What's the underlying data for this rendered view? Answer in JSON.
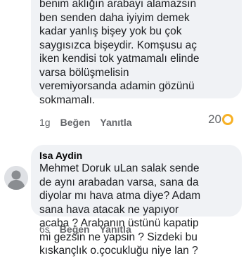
{
  "comments": [
    {
      "text": "benim aklığın arabayı alamazsın\nben senden daha iyiyim demek\nkadar yanlış bişey yok bu çok\nsaygısızca bişeydir. Komşusu aç\niken kendisi tok yatmamalı elinde\nvarsa bölüşmelisin\nveremiyorsanda adamin gözünü\nsokmamalı.",
      "time": "1g",
      "like_label": "Beğen",
      "reply_label": "Yanıtla",
      "reaction_count": "20",
      "reaction_icon": "reaction-icon"
    },
    {
      "author": "Isa Aydin",
      "text": "Mehmet Doruk uLan salak sende\nde aynı arabadan varsa, sana da\ndiyolar mı hava atma diye? Adam\nsana hava atacak ne yapıyor\nacaba ? Arabanın üstünü kapatip\nmi gezsin ne yapsin ? Sizdeki bu\nkıskançlık o.çocukluğu niye lan ?",
      "time": "6s",
      "like_label": "Beğen",
      "reply_label": "Yanıtla",
      "avatar_icon": "user-avatar-icon"
    }
  ],
  "colors": {
    "bubble": "#f0f2f5",
    "text": "#1c1e21",
    "meta": "#65676b",
    "reaction": "#f7b125"
  }
}
